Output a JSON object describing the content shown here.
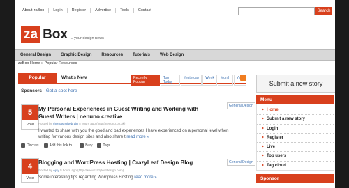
{
  "topnav": {
    "items": [
      "About zaBox",
      "Login",
      "Register",
      "Advertise",
      "Tools",
      "Contact"
    ]
  },
  "search": {
    "placeholder": "",
    "button_label": "Search"
  },
  "logo": {
    "za": "za",
    "box": "Box",
    "tagline": "... your design news"
  },
  "mainnav": {
    "items": [
      "General Design",
      "Graphic Design",
      "Resources",
      "Tutorials",
      "Web Design"
    ]
  },
  "breadcrumb": "zaBox Home » Popular Resources",
  "tabs": {
    "popular": "Popular Resources",
    "new": "What's New"
  },
  "filters": [
    "Recently Popular",
    "Top Today",
    "Yesterday",
    "Week",
    "Month",
    "Year"
  ],
  "sponsors": {
    "label": "Sponsors",
    "link": "- Get a spot here"
  },
  "stories": [
    {
      "votes": "5",
      "vote_label": "Vote",
      "title": "My Personal Experiences in Guest Writing and Working with Guest Writers | nenuno creative",
      "category": "General Design",
      "posted_by": "Posted by",
      "author": "thomasnoisebrain",
      "time": "5 hours ago",
      "url": "(http://nenuno.co.uk)",
      "description": "I wanted to share with you the good and bad experiences I have experienced on a personal level when writing for various design sites and also share t",
      "more": "read more »",
      "actions": [
        "Discuss",
        "Add this link to...",
        "Bury",
        "Tags"
      ]
    },
    {
      "votes": "4",
      "vote_label": "Vote",
      "title": "Blogging and WordPress Hosting | CrazyLeaf Design Blog",
      "category": "General Design",
      "posted_by": "Posted by",
      "author": "Ajay",
      "time": "5 hours ago",
      "url": "(http://www.crazyleafdesign.com)",
      "description": "Some interesting tips regarding Wordpress Hosting",
      "more": "read more »"
    }
  ],
  "sidebar": {
    "submit": "Submit a new story",
    "menu_title": "Menu",
    "menu_items": [
      "Home",
      "Submit a new story",
      "Login",
      "Register",
      "Live",
      "Top users",
      "Tag cloud"
    ],
    "sponsor_title": "Sponsor"
  },
  "colors": {
    "accent": "#d8401d",
    "link": "#3a6fb0",
    "background": "#1b1b1b"
  }
}
